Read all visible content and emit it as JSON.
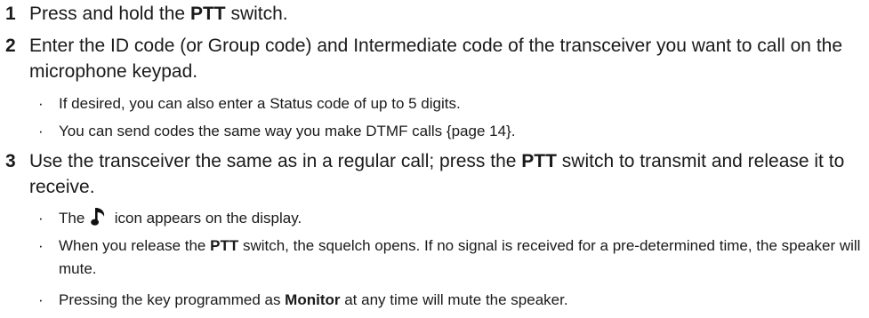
{
  "steps": [
    {
      "number": "1",
      "text_before": "Press and hold the ",
      "bold": "PTT",
      "text_after": " switch."
    },
    {
      "number": "2",
      "text": "Enter the ID code (or Group code) and Intermediate code of the transceiver you want to call on the microphone keypad.",
      "bullets": [
        "If desired, you can also enter a Status code of up to 5 digits.",
        "You can send codes the same way you make DTMF calls {page 14}."
      ]
    },
    {
      "number": "3",
      "text_before": "Use the transceiver the same as in a regular call; press the ",
      "bold": "PTT",
      "text_after": " switch to transmit and release it to receive.",
      "bullets": {
        "b1_before": "The ",
        "b1_icon": "music-note-icon",
        "b1_after": " icon appears on the display.",
        "b2_before": "When you release the ",
        "b2_bold": "PTT",
        "b2_after": " switch, the squelch opens.  If no signal is received for a pre-determined time, the speaker will mute.",
        "b3_before": "Pressing the key programmed as ",
        "b3_bold": "Monitor",
        "b3_after": " at any time will mute the speaker."
      }
    }
  ],
  "bullet_glyph": "·"
}
